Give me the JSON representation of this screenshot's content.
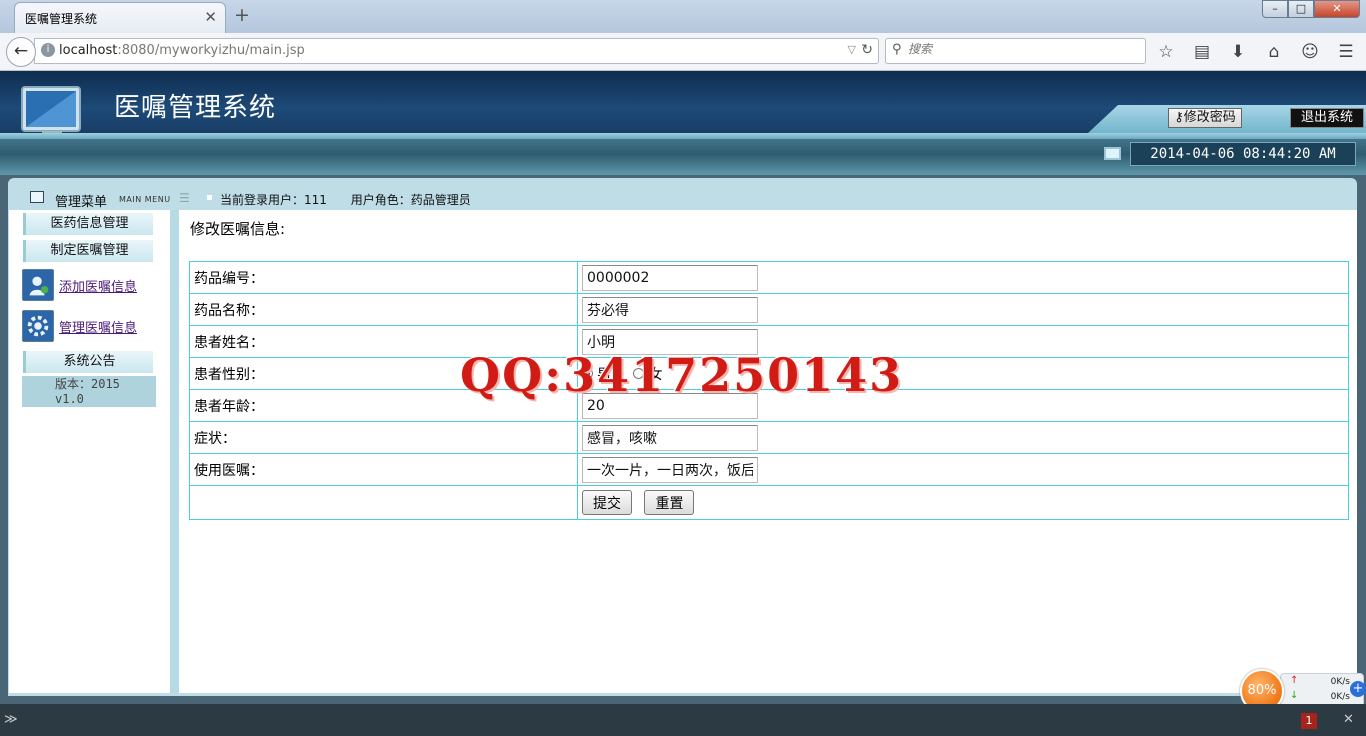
{
  "browser": {
    "tab_title": "医嘱管理系统",
    "url_host": "localhost",
    "url_rest": ":8080/myworkyizhu/main.jsp",
    "search_placeholder": "搜索"
  },
  "header": {
    "title": "医嘱管理系统",
    "change_password": "修改密码",
    "logout": "退出系统",
    "datetime": "2014-04-06 08:44:20 AM"
  },
  "menu": {
    "title": "管理菜单",
    "title_en": "MAIN MENU",
    "user_label": "当前登录用户：111",
    "role_label": "用户角色：药品管理员",
    "sections": {
      "drug_info": "医药信息管理",
      "order": "制定医嘱管理",
      "add_order": "添加医嘱信息",
      "manage_order": "管理医嘱信息",
      "notice": "系统公告"
    },
    "version_line1": "版本：2015",
    "version_line2": "v1.0"
  },
  "form": {
    "heading": "修改医嘱信息:",
    "labels": {
      "drug_id": "药品编号：",
      "drug_name": "药品名称：",
      "patient_name": "患者姓名：",
      "patient_gender": "患者性别：",
      "patient_age": "患者年龄：",
      "symptom": "症状：",
      "usage": "使用医嘱："
    },
    "values": {
      "drug_id": "0000002",
      "drug_name": "芬必得",
      "patient_name": "小明",
      "gender_male": "男",
      "gender_female": "女",
      "patient_age": "20",
      "symptom": "感冒，咳嗽",
      "usage": "一次一片，一日两次，饭后"
    },
    "submit": "提交",
    "reset": "重置"
  },
  "watermark": "QQ:3417250143",
  "speed": {
    "percent": "80%",
    "up": "0K/s",
    "down": "0K/s"
  },
  "bottom": {
    "badge": "1"
  }
}
